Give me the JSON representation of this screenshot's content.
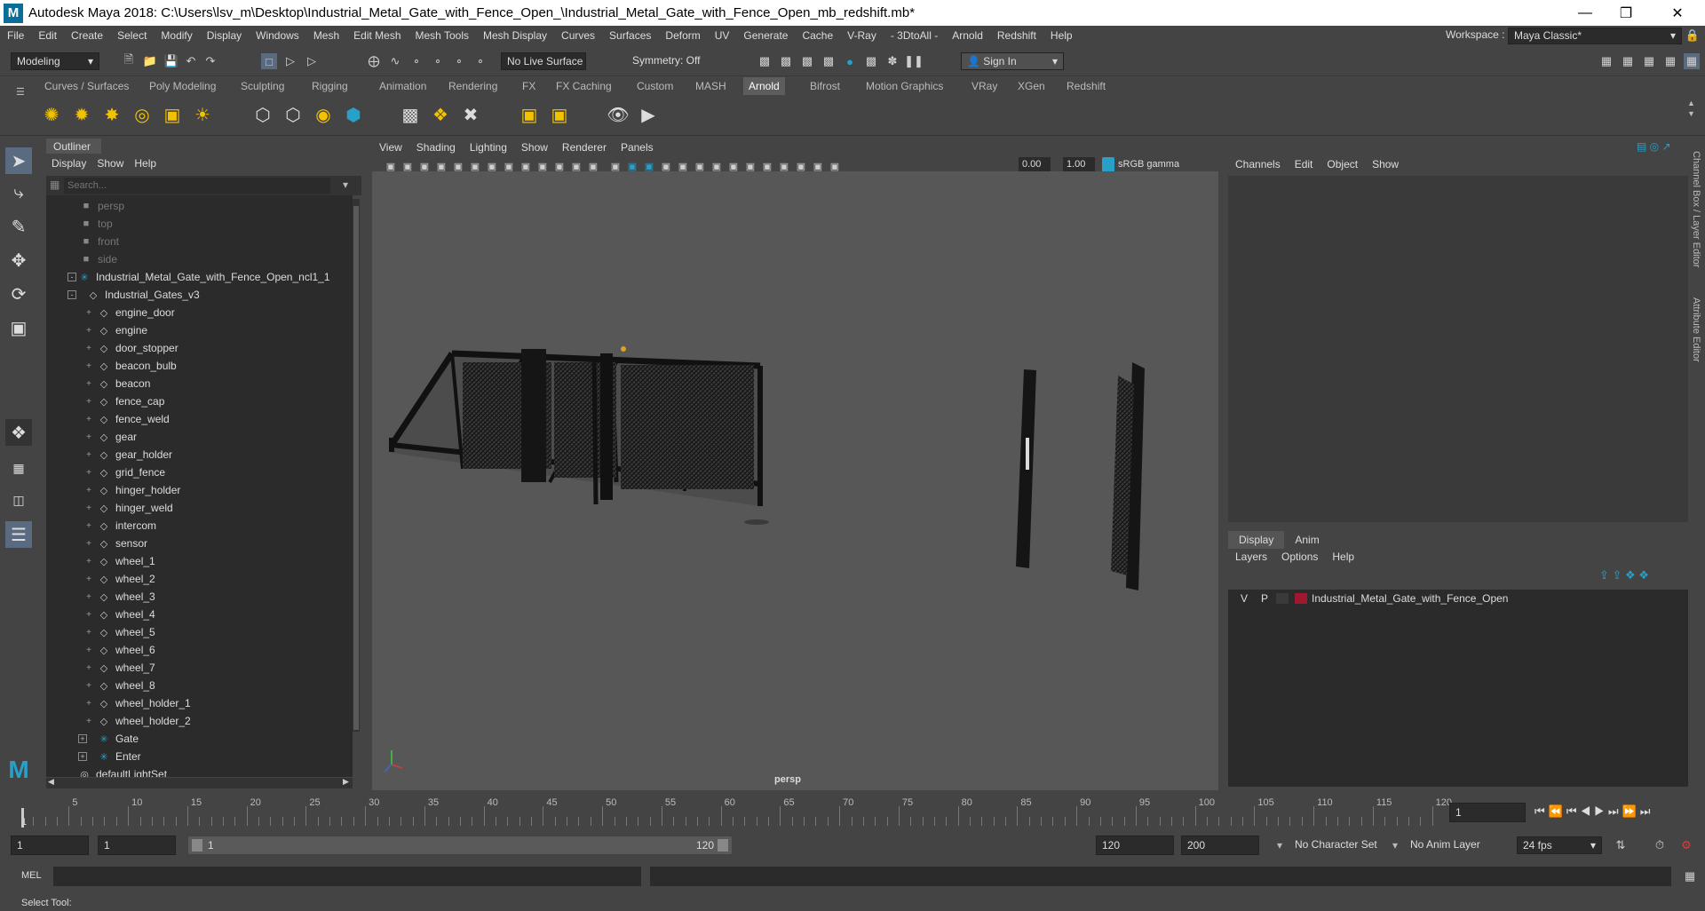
{
  "window": {
    "title": "Autodesk Maya 2018: C:\\Users\\lsv_m\\Desktop\\Industrial_Metal_Gate_with_Fence_Open_\\Industrial_Metal_Gate_with_Fence_Open_mb_redshift.mb*",
    "logo": "M"
  },
  "menus": [
    "File",
    "Edit",
    "Create",
    "Select",
    "Modify",
    "Display",
    "Windows",
    "Mesh",
    "Edit Mesh",
    "Mesh Tools",
    "Mesh Display",
    "Curves",
    "Surfaces",
    "Deform",
    "UV",
    "Generate",
    "Cache",
    "V-Ray",
    "- 3DtoAll -",
    "Arnold",
    "Redshift",
    "Help"
  ],
  "workspace": {
    "label": "Workspace :",
    "value": "Maya Classic*"
  },
  "statusline": {
    "mode": "Modeling",
    "live_surface": "No Live Surface",
    "symmetry": "Symmetry: Off",
    "sign_in": "Sign In"
  },
  "shelf_tabs": [
    "Curves / Surfaces",
    "Poly Modeling",
    "Sculpting",
    "Rigging",
    "Animation",
    "Rendering",
    "FX",
    "FX Caching",
    "Custom",
    "MASH",
    "Arnold",
    "Bifrost",
    "Motion Graphics",
    "VRay",
    "XGen",
    "Redshift"
  ],
  "shelf_active": "Arnold",
  "outliner": {
    "title": "Outliner",
    "menus": [
      "Display",
      "Show",
      "Help"
    ],
    "search_placeholder": "Search...",
    "items": [
      {
        "label": "persp",
        "indent": 0,
        "kind": "camera",
        "dim": true
      },
      {
        "label": "top",
        "indent": 0,
        "kind": "camera",
        "dim": true
      },
      {
        "label": "front",
        "indent": 0,
        "kind": "camera",
        "dim": true
      },
      {
        "label": "side",
        "indent": 0,
        "kind": "camera",
        "dim": true
      },
      {
        "label": "Industrial_Metal_Gate_with_Fence_Open_ncl1_1",
        "indent": 0,
        "kind": "group",
        "expand": "-"
      },
      {
        "label": "Industrial_Gates_v3",
        "indent": 1,
        "kind": "mesh",
        "expand": "-"
      },
      {
        "label": "engine_door",
        "indent": 2,
        "kind": "mesh"
      },
      {
        "label": "engine",
        "indent": 2,
        "kind": "mesh"
      },
      {
        "label": "door_stopper",
        "indent": 2,
        "kind": "mesh"
      },
      {
        "label": "beacon_bulb",
        "indent": 2,
        "kind": "mesh"
      },
      {
        "label": "beacon",
        "indent": 2,
        "kind": "mesh"
      },
      {
        "label": "fence_cap",
        "indent": 2,
        "kind": "mesh"
      },
      {
        "label": "fence_weld",
        "indent": 2,
        "kind": "mesh"
      },
      {
        "label": "gear",
        "indent": 2,
        "kind": "mesh"
      },
      {
        "label": "gear_holder",
        "indent": 2,
        "kind": "mesh"
      },
      {
        "label": "grid_fence",
        "indent": 2,
        "kind": "mesh"
      },
      {
        "label": "hinger_holder",
        "indent": 2,
        "kind": "mesh"
      },
      {
        "label": "hinger_weld",
        "indent": 2,
        "kind": "mesh"
      },
      {
        "label": "intercom",
        "indent": 2,
        "kind": "mesh"
      },
      {
        "label": "sensor",
        "indent": 2,
        "kind": "mesh"
      },
      {
        "label": "wheel_1",
        "indent": 2,
        "kind": "mesh"
      },
      {
        "label": "wheel_2",
        "indent": 2,
        "kind": "mesh"
      },
      {
        "label": "wheel_3",
        "indent": 2,
        "kind": "mesh"
      },
      {
        "label": "wheel_4",
        "indent": 2,
        "kind": "mesh"
      },
      {
        "label": "wheel_5",
        "indent": 2,
        "kind": "mesh"
      },
      {
        "label": "wheel_6",
        "indent": 2,
        "kind": "mesh"
      },
      {
        "label": "wheel_7",
        "indent": 2,
        "kind": "mesh"
      },
      {
        "label": "wheel_8",
        "indent": 2,
        "kind": "mesh"
      },
      {
        "label": "wheel_holder_1",
        "indent": 2,
        "kind": "mesh"
      },
      {
        "label": "wheel_holder_2",
        "indent": 2,
        "kind": "mesh"
      },
      {
        "label": "Gate",
        "indent": 2,
        "kind": "group",
        "expand": "+"
      },
      {
        "label": "Enter",
        "indent": 2,
        "kind": "group",
        "expand": "+"
      },
      {
        "label": "defaultLightSet",
        "indent": 0,
        "kind": "set"
      }
    ]
  },
  "viewport": {
    "menus": [
      "View",
      "Shading",
      "Lighting",
      "Show",
      "Renderer",
      "Panels"
    ],
    "exposure": "0.00",
    "gamma": "1.00",
    "color_space": "sRGB gamma",
    "camera_label": "persp"
  },
  "channelbox": {
    "menus": [
      "Channels",
      "Edit",
      "Object",
      "Show"
    ],
    "side_tab_1": "Channel Box / Layer Editor",
    "side_tab_2": "Attribute Editor"
  },
  "layers": {
    "tabs": [
      "Display",
      "Anim"
    ],
    "menus": [
      "Layers",
      "Options",
      "Help"
    ],
    "row": {
      "v": "V",
      "p": "P",
      "name": "Industrial_Metal_Gate_with_Fence_Open",
      "color": "#a0182f"
    }
  },
  "timeline": {
    "ticks": [
      "5",
      "10",
      "15",
      "20",
      "25",
      "30",
      "35",
      "40",
      "45",
      "50",
      "55",
      "60",
      "65",
      "70",
      "75",
      "80",
      "85",
      "90",
      "95",
      "100",
      "105",
      "110",
      "115",
      "120"
    ],
    "start_label": "1",
    "current_frame": "1"
  },
  "range": {
    "start": "1",
    "anim_start": "1",
    "range_start": "1",
    "range_end": "120",
    "end": "120",
    "anim_end": "200",
    "char_set": "No Character Set",
    "anim_layer": "No Anim Layer",
    "fps": "24 fps"
  },
  "cmd": {
    "label": "MEL"
  },
  "help_line": "Select Tool:"
}
